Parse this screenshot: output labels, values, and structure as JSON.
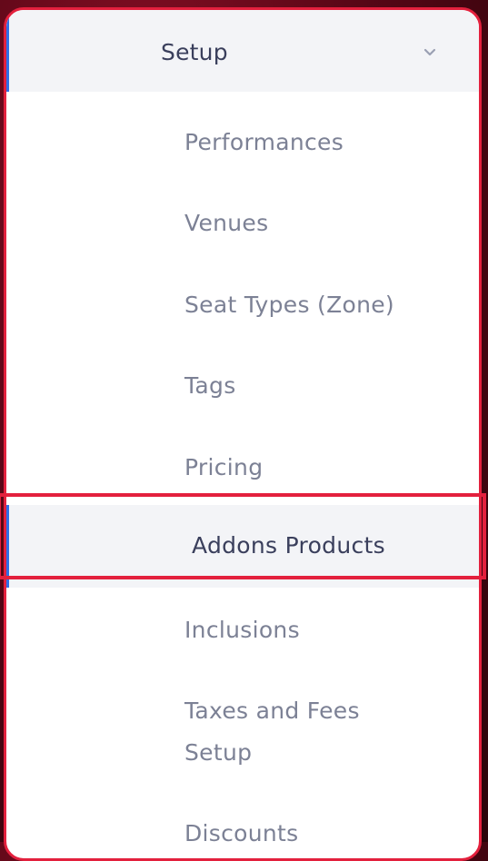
{
  "menu": {
    "header": {
      "label": "Setup",
      "icon": "chevron-down-icon"
    },
    "items": [
      {
        "label": "Performances"
      },
      {
        "label": "Venues"
      },
      {
        "label": "Seat Types (Zone)"
      },
      {
        "label": "Tags"
      },
      {
        "label": "Pricing"
      },
      {
        "label": "Addons Products",
        "active": true
      },
      {
        "label": "Inclusions"
      },
      {
        "label": "Taxes and Fees\nSetup"
      },
      {
        "label": "Discounts"
      }
    ]
  },
  "colors": {
    "accent_highlight": "#e3203d",
    "active_bg": "#f3f4f7",
    "active_bar": "#2f6fe6",
    "text_primary": "#3a3f5c",
    "text_muted": "#7c8195"
  }
}
